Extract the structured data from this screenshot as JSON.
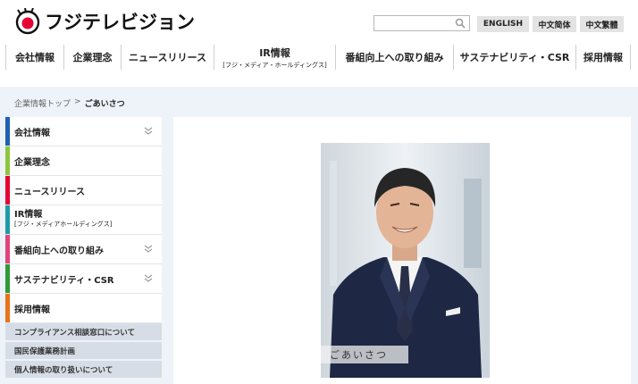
{
  "header": {
    "logo_text": "フジテレビジョン",
    "search": {
      "placeholder": ""
    },
    "languages": [
      "ENGLISH",
      "中文简体",
      "中文繁體"
    ]
  },
  "global_nav": [
    {
      "label": "会社情報",
      "sub": ""
    },
    {
      "label": "企業理念",
      "sub": ""
    },
    {
      "label": "ニュースリリース",
      "sub": ""
    },
    {
      "label": "IR情報",
      "sub": "[フジ・メディア・ホールディングス]"
    },
    {
      "label": "番組向上への取り組み",
      "sub": ""
    },
    {
      "label": "サステナビリティ・CSR",
      "sub": ""
    },
    {
      "label": "採用情報",
      "sub": ""
    }
  ],
  "breadcrumb": {
    "home": "企業情報トップ",
    "separator": ">",
    "current": "ごあいさつ"
  },
  "sidebar": {
    "items": [
      {
        "label": "会社情報",
        "sub": "",
        "color": "#1f5fb5",
        "chevron": true
      },
      {
        "label": "企業理念",
        "sub": "",
        "color": "#8cc63f",
        "chevron": false
      },
      {
        "label": "ニュースリリース",
        "sub": "",
        "color": "#e60033",
        "chevron": false
      },
      {
        "label": "IR情報",
        "sub": "[フジ・メディアホールディングス]",
        "color": "#1f9aa8",
        "chevron": false
      },
      {
        "label": "番組向上への取り組み",
        "sub": "",
        "color": "#e0447a",
        "chevron": true
      },
      {
        "label": "サステナビリティ・CSR",
        "sub": "",
        "color": "#2e9a3a",
        "chevron": true
      },
      {
        "label": "採用情報",
        "sub": "",
        "color": "#e8731a",
        "chevron": false
      }
    ],
    "sub_links": [
      "コンプライアンス相談窓口について",
      "国民保護業務計画",
      "個人情報の取り扱いについて"
    ]
  },
  "main": {
    "photo_caption": "ごあいさつ"
  },
  "colors": {
    "accent_red": "#e60033",
    "content_bg": "#edf3f8",
    "sub_link_bg": "#d7dde6"
  }
}
